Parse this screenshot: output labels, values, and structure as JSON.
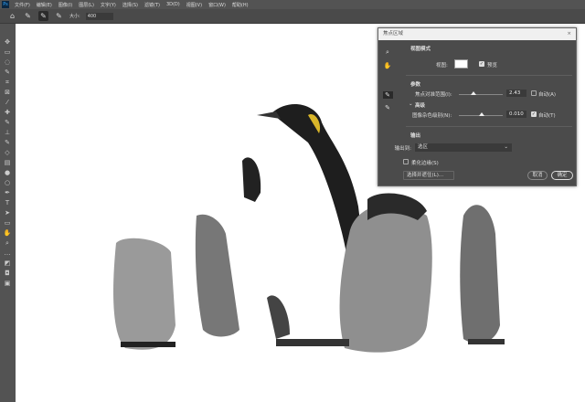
{
  "menubar": {
    "logo": "Ps",
    "items": [
      "文件(F)",
      "编辑(E)",
      "图像(I)",
      "图层(L)",
      "文字(Y)",
      "选择(S)",
      "滤镜(T)",
      "3D(D)",
      "视图(V)",
      "窗口(W)",
      "帮助(H)"
    ]
  },
  "options": {
    "size_label": "大小:",
    "size_value": "400"
  },
  "dialog": {
    "title": "焦点区域",
    "view_mode_header": "视图模式",
    "view_label": "视图:",
    "preview_label": "预览",
    "preview_checked": true,
    "params_header": "参数",
    "focus_range_label": "焦点对准范围(I):",
    "focus_range_value": "2.43",
    "focus_auto_label": "自动(A)",
    "focus_auto_checked": false,
    "advanced_label": "高级",
    "noise_label": "图像杂色级别(N):",
    "noise_value": "0.010",
    "noise_auto_label": "自动(T)",
    "noise_auto_checked": true,
    "output_header": "输出",
    "output_to_label": "输出到:",
    "output_to_value": "选区",
    "soften_label": "柔化边缘(S)",
    "soften_checked": false,
    "select_mask_button": "选择并遮住(L)...",
    "cancel_button": "取消",
    "ok_button": "确定"
  }
}
